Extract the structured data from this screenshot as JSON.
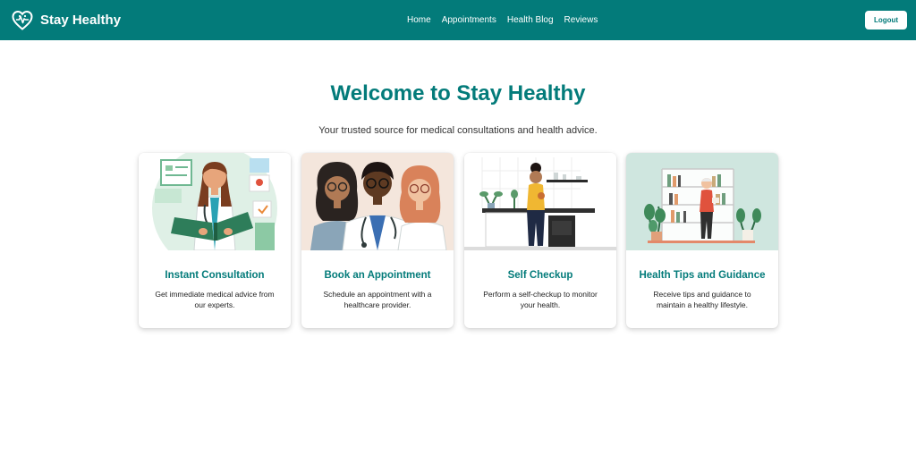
{
  "header": {
    "brand": "Stay Healthy",
    "nav": [
      "Home",
      "Appointments",
      "Health Blog",
      "Reviews"
    ],
    "logout_label": "Logout"
  },
  "hero": {
    "title": "Welcome to Stay Healthy",
    "subtitle": "Your trusted source for medical consultations and health advice."
  },
  "cards": [
    {
      "title": "Instant Consultation",
      "description": "Get immediate medical advice from our experts.",
      "image": "doctor-reading-chart-illustration"
    },
    {
      "title": "Book an Appointment",
      "description": "Schedule an appointment with a healthcare provider.",
      "image": "three-doctors-illustration"
    },
    {
      "title": "Self Checkup",
      "description": "Perform a self-checkup to monitor your health.",
      "image": "woman-in-kitchen-illustration"
    },
    {
      "title": "Health Tips and Guidance",
      "description": "Receive tips and guidance to maintain a healthy lifestyle.",
      "image": "man-reading-by-bookshelf-illustration"
    }
  ],
  "colors": {
    "brand": "#037b7a",
    "background": "#ffffff",
    "text": "#222222"
  }
}
